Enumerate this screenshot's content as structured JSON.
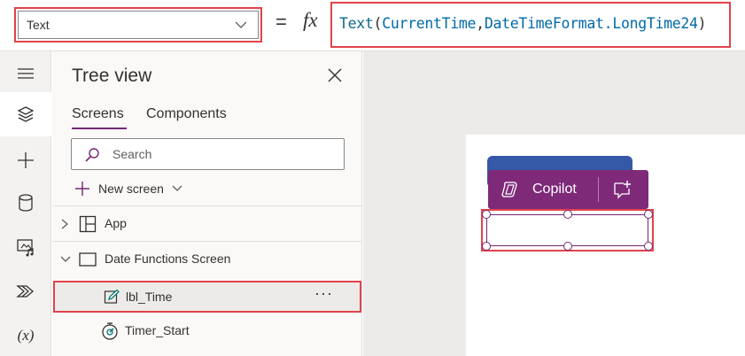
{
  "formula_bar": {
    "property": "Text",
    "equals": "=",
    "fx": "fx",
    "formula": {
      "fn": "Text",
      "open": "(",
      "arg1": "CurrentTime",
      "comma": ",",
      "arg2": "DateTimeFormat.LongTime24",
      "close": ")"
    }
  },
  "rail": {
    "items": [
      "menu-icon",
      "layers-icon",
      "insert-icon",
      "data-icon",
      "media-icon",
      "power-automate-icon"
    ],
    "variables_label": "(x)"
  },
  "tree": {
    "title": "Tree view",
    "tabs": [
      "Screens",
      "Components"
    ],
    "search_placeholder": "Search",
    "new_screen": "New screen",
    "rows": {
      "app": "App",
      "screen": "Date Functions Screen",
      "lbl_time": "lbl_Time",
      "timer": "Timer_Start"
    },
    "more": "···"
  },
  "canvas": {
    "copilot_label": "Copilot"
  },
  "colors": {
    "highlight": "#e2434b",
    "brand": "#742774",
    "copilot_bg": "#7e2a79",
    "timer_bg": "#3559a7"
  }
}
